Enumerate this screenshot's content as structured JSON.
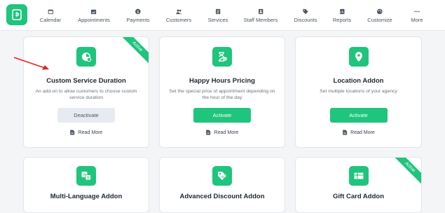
{
  "nav": {
    "items": [
      {
        "label": "Calendar",
        "icon": "calendar-icon"
      },
      {
        "label": "Appointments",
        "icon": "appointments-icon"
      },
      {
        "label": "Payments",
        "icon": "payments-icon"
      },
      {
        "label": "Customers",
        "icon": "customers-icon"
      },
      {
        "label": "Services",
        "icon": "services-icon"
      },
      {
        "label": "Staff Members",
        "icon": "staff-icon"
      },
      {
        "label": "Discounts",
        "icon": "tag-icon"
      },
      {
        "label": "Reports",
        "icon": "reports-icon"
      },
      {
        "label": "Customize",
        "icon": "palette-icon"
      },
      {
        "label": "More",
        "icon": "more-icon"
      }
    ]
  },
  "addons": [
    {
      "title": "Custom Service Duration",
      "description": "An add-on to allow customers to choose custom service duration",
      "button": "Deactivate",
      "read_more": "Read More",
      "badge": "Active"
    },
    {
      "title": "Happy Hours Pricing",
      "description": "Set the special price of appointment depending on the hour of the day",
      "button": "Activate",
      "read_more": "Read More"
    },
    {
      "title": "Location Addon",
      "description": "Set multiple locations of your agency",
      "button": "Activate",
      "read_more": "Read More"
    },
    {
      "title": "Multi-Language Addon"
    },
    {
      "title": "Advanced Discount Addon"
    },
    {
      "title": "Gift Card Addon",
      "badge": "Active"
    }
  ],
  "colors": {
    "accent": "#1fc47d",
    "annotation_arrow": "#e02424"
  }
}
